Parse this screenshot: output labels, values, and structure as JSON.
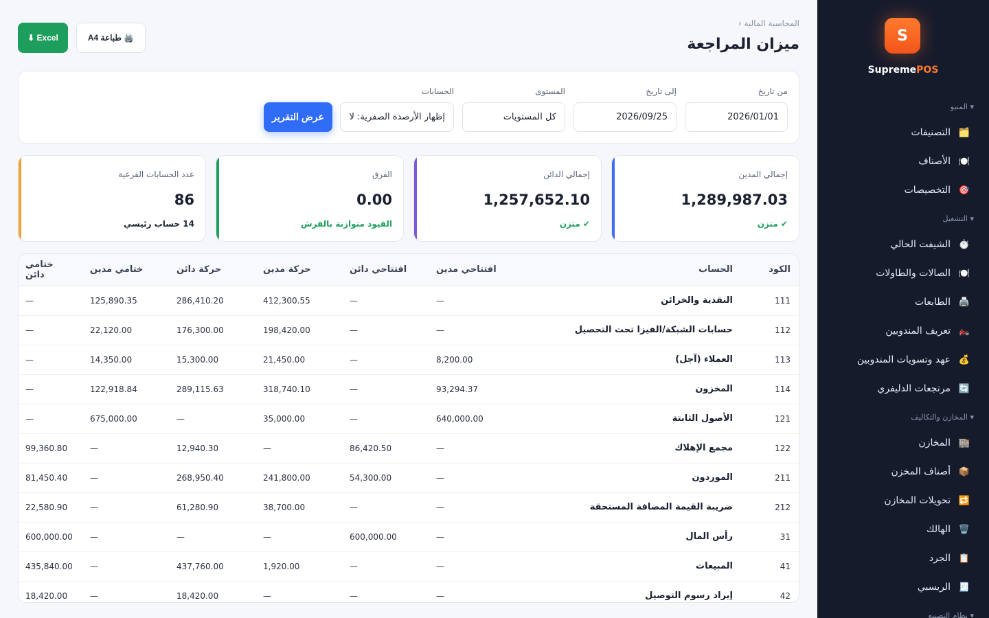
{
  "brand": {
    "logo_letter": "S",
    "name_part1": "Supreme",
    "name_part2": "POS"
  },
  "sidebar": {
    "sections": [
      {
        "label": "▾ المنيو",
        "items": [
          {
            "icon": "🗂️",
            "label": "التصنيفات"
          },
          {
            "icon": "🍽️",
            "label": "الأصناف"
          },
          {
            "icon": "🎯",
            "label": "التخصيصات"
          }
        ]
      },
      {
        "label": "▾ التشغيل",
        "items": [
          {
            "icon": "⏱️",
            "label": "الشيفت الحالي"
          },
          {
            "icon": "🍽️",
            "label": "الصالات والطاولات"
          },
          {
            "icon": "🖨️",
            "label": "الطابعات"
          },
          {
            "icon": "🏍️",
            "label": "تعريف المندوبين"
          },
          {
            "icon": "💰",
            "label": "عهد وتسويات المندوبين"
          },
          {
            "icon": "🔄",
            "label": "مرتجعات الدليفري"
          }
        ]
      },
      {
        "label": "▾ المخازن والتكاليف",
        "items": [
          {
            "icon": "🏬",
            "label": "المخازن"
          },
          {
            "icon": "📦",
            "label": "أصناف المخزن"
          },
          {
            "icon": "🔁",
            "label": "تحويلات المخازن"
          },
          {
            "icon": "🗑️",
            "label": "الهالك"
          },
          {
            "icon": "📋",
            "label": "الجرد"
          },
          {
            "icon": "🧾",
            "label": "الريسبي"
          }
        ]
      },
      {
        "label": "▾ نظام التصنيع",
        "items": []
      }
    ]
  },
  "header": {
    "breadcrumb": "المحاسبة المالية ‹",
    "title": "ميزان المراجعة",
    "excel_label": "Excel ⬇",
    "print_label": "🖨️ طباعة A4"
  },
  "filters": {
    "from_label": "من تاريخ",
    "from_value": "2026/01/01",
    "to_label": "إلى تاريخ",
    "to_value": "2026/09/25",
    "level_label": "المستوى",
    "level_value": "كل المستويات",
    "accounts_label": "الحسابات",
    "accounts_value": "إظهار الأرصدة الصفرية: لا",
    "show_button": "عرض التقرير"
  },
  "stats": [
    {
      "label": "إجمالي المدين",
      "value": "1,289,987.03",
      "note": "✔ متزن",
      "bar_color": "#3b6df0",
      "note_color": "#1e9e5c"
    },
    {
      "label": "إجمالي الدائن",
      "value": "1,257,652.10",
      "note": "✔ متزن",
      "bar_color": "#7b5ad6",
      "note_color": "#1e9e5c"
    },
    {
      "label": "الفرق",
      "value": "0.00",
      "note": "القيود متوازنة بالقرش",
      "bar_color": "#1e9e5c",
      "note_color": "#1e9e5c"
    },
    {
      "label": "عدد الحسابات الفرعية",
      "value": "86",
      "note": "14 حساب رئيسي",
      "bar_color": "#f0a33b",
      "note_color": "#1f2430"
    }
  ],
  "table": {
    "headers": [
      "الكود",
      "الحساب",
      "افتتاحي مدين",
      "افتتاحي دائن",
      "حركة مدين",
      "حركة دائن",
      "ختامي مدين",
      "ختامي دائن"
    ],
    "rows": [
      [
        "111",
        "النقدية والخزائن",
        "—",
        "—",
        "412,300.55",
        "286,410.20",
        "125,890.35",
        "—"
      ],
      [
        "112",
        "حسابات الشبكة/الفيزا تحت التحصيل",
        "—",
        "—",
        "198,420.00",
        "176,300.00",
        "22,120.00",
        "—"
      ],
      [
        "113",
        "العملاء (آجل)",
        "8,200.00",
        "—",
        "21,450.00",
        "15,300.00",
        "14,350.00",
        "—"
      ],
      [
        "114",
        "المخزون",
        "93,294.37",
        "—",
        "318,740.10",
        "289,115.63",
        "122,918.84",
        "—"
      ],
      [
        "121",
        "الأصول الثابتة",
        "640,000.00",
        "—",
        "35,000.00",
        "—",
        "675,000.00",
        "—"
      ],
      [
        "122",
        "مجمع الإهلاك",
        "—",
        "86,420.50",
        "—",
        "12,940.30",
        "—",
        "99,360.80"
      ],
      [
        "211",
        "الموردون",
        "—",
        "54,300.00",
        "241,800.00",
        "268,950.40",
        "—",
        "81,450.40"
      ],
      [
        "212",
        "ضريبة القيمة المضافة المستحقة",
        "—",
        "—",
        "38,700.00",
        "61,280.90",
        "—",
        "22,580.90"
      ],
      [
        "31",
        "رأس المال",
        "—",
        "600,000.00",
        "—",
        "—",
        "—",
        "600,000.00"
      ],
      [
        "41",
        "المبيعات",
        "—",
        "—",
        "1,920.00",
        "437,760.00",
        "—",
        "435,840.00"
      ],
      [
        "42",
        "إيراد رسوم التوصيل",
        "—",
        "—",
        "—",
        "18,420.00",
        "—",
        "18,420.00"
      ]
    ]
  }
}
